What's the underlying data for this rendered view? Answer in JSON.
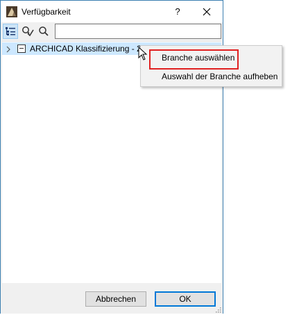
{
  "window": {
    "title": "Verfügbarkeit",
    "help_label": "?",
    "icons": {
      "app": "archicad-app-icon",
      "close": "close-icon"
    }
  },
  "toolbar": {
    "icons": [
      "tree-view-icon",
      "filter-check-icon",
      "search-icon"
    ],
    "search": {
      "value": "",
      "placeholder": ""
    }
  },
  "tree": {
    "items": [
      {
        "label": "ARCHICAD Klassifizierung - 21",
        "expanded": false,
        "selected": true
      }
    ]
  },
  "context_menu": {
    "items": [
      {
        "label": "Branche auswählen",
        "highlighted": true
      },
      {
        "label": "Auswahl der Branche aufheben",
        "highlighted": false
      }
    ]
  },
  "footer": {
    "cancel_label": "Abbrechen",
    "ok_label": "OK"
  },
  "colors": {
    "selection": "#cde8ff",
    "annotation_box": "#e02020",
    "default_button_border": "#0078d7"
  }
}
